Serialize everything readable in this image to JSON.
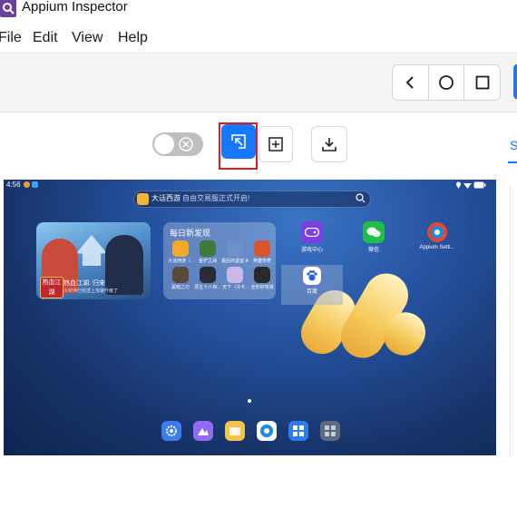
{
  "window": {
    "title": "Appium Inspector"
  },
  "menu": [
    "File",
    "Edit",
    "View",
    "Help"
  ],
  "colors": {
    "accent": "#1677ff",
    "highlight_border": "#e0191e"
  },
  "nav_buttons": {
    "back": "back-icon",
    "home": "home-icon",
    "recents": "recents-icon"
  },
  "side_tab": {
    "label": "S"
  },
  "device": {
    "status": {
      "time": "4:56"
    },
    "search": {
      "game_name": "大话西游",
      "hint": "自由交易服正式开启!"
    },
    "banner": {
      "logo": "热血江湖",
      "title": "热血江湖: 归来",
      "subtitle": "小伙伴已经送上加速升级了"
    },
    "daily": {
      "title": "每日新发现",
      "items": [
        "大话西游（..",
        "金铲之战",
        "最后的堡垒 A",
        "英雄传奇",
        "黑暗之刃",
        "原生十八世...",
        "天下（冷卡..",
        "全你好攻城"
      ]
    },
    "apps": [
      {
        "label": "游戏中心"
      },
      {
        "label": "微信"
      },
      {
        "label": "Appium Setti..."
      },
      {
        "label": "百度"
      }
    ],
    "dock": [
      "settings-icon",
      "gallery-icon",
      "files-icon",
      "browser-icon",
      "appstore-icon",
      "folder-icon"
    ]
  }
}
